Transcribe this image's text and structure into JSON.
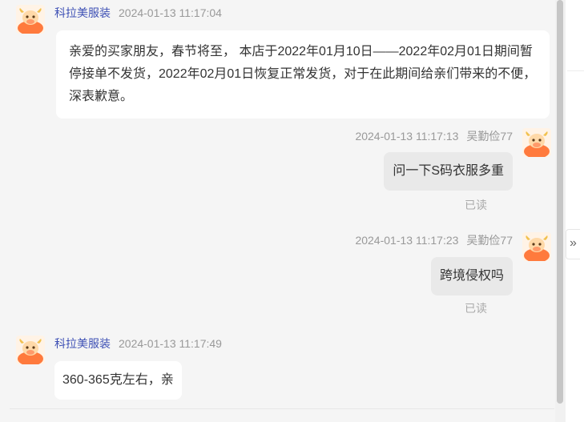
{
  "messages": [
    {
      "sender": "科拉美服装",
      "time": "2024-01-13 11:17:04",
      "text": "亲爱的买家朋友，春节将至， 本店于2022年01月10日——2022年02月01日期间暂停接单不发货，2022年02月01日恢复正常发货，对于在此期间给亲们带来的不便，深表歉意。"
    },
    {
      "sender": "吴勤俭77",
      "time": "2024-01-13 11:17:13",
      "text": "问一下S码衣服多重",
      "status": "已读"
    },
    {
      "sender": "吴勤俭77",
      "time": "2024-01-13 11:17:23",
      "text": "跨境侵权吗",
      "status": "已读"
    },
    {
      "sender": "科拉美服装",
      "time": "2024-01-13 11:17:49",
      "text": "360-365克左右，亲"
    }
  ],
  "side_panel": {
    "expand_icon": "double-chevron-right-icon",
    "expand_glyph": "»"
  },
  "colors": {
    "background": "#f5f5f5",
    "seller_name": "#3f51b5",
    "outgoing_bubble": "#e9e9e9",
    "incoming_bubble": "#ffffff",
    "avatar_orange": "#ff7a3d"
  }
}
